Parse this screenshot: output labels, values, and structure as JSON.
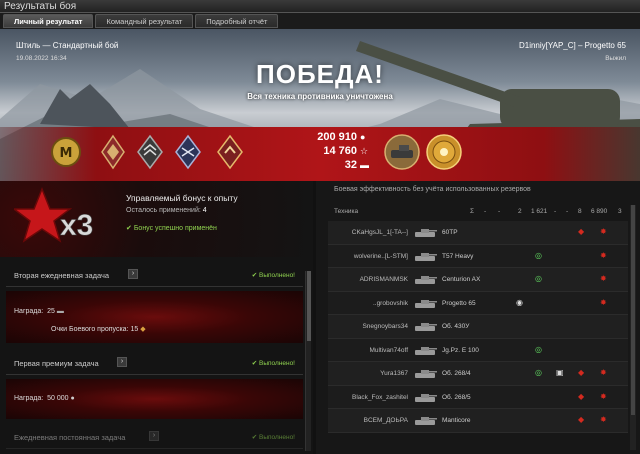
{
  "window": {
    "title": "Результаты боя"
  },
  "tabs": [
    {
      "label": "Личный результат",
      "active": true
    },
    {
      "label": "Командный результат",
      "active": false
    },
    {
      "label": "Подробный отчёт",
      "active": false
    }
  ],
  "battle": {
    "map_mode": "Штиль — Стандартный бой",
    "date": "19.08.2022 16:34",
    "player": "D1inniy[YAP_C] – Progetto 65",
    "status": "Выжил",
    "result": "ПОБЕДА!",
    "result_sub": "Вся техника противника уничтожена"
  },
  "stats": {
    "credits": "200 910",
    "credits_icon": "credits-icon",
    "xp": "14 760",
    "xp_icon": "star-icon",
    "bonds": "32",
    "bonds_icon": "bonds-icon"
  },
  "medals_left": [
    "mastery-badge-icon",
    "rank-badge-1-icon",
    "rank-badge-2-icon",
    "rank-badge-3-icon",
    "rank-badge-4-icon"
  ],
  "medals_right": [
    "tank-medal-icon",
    "gold-medal-icon"
  ],
  "bonus": {
    "multiplier": "x3",
    "title": "Управляемый бонус к опыту",
    "remaining_label": "Осталось применений:",
    "remaining_value": "4",
    "applied": "Бонус успешно применён"
  },
  "tasks": [
    {
      "name": "Вторая ежедневная задача",
      "status": "Выполнено!",
      "reward_label": "Награда:",
      "reward_value": "25",
      "pass_label": "Очки Боевого пропуска:",
      "pass_value": "15"
    },
    {
      "name": "Первая премиум задача",
      "status": "Выполнено!",
      "reward_label": "Награда:",
      "reward_value": "50 000"
    },
    {
      "name": "Ежедневная постоянная задача",
      "status": "Выполнено!"
    }
  ],
  "efficiency": {
    "title": "Боевая эффективность без учёта использованных резервов",
    "columns": {
      "tech": "Техника",
      "sigma": "Σ",
      "d1": "-",
      "d2": "-",
      "c2": "2",
      "c1621": "1 621",
      "d3": "-",
      "d4": "-",
      "c8": "8",
      "c6890": "6 890",
      "c3": "3"
    },
    "players": [
      {
        "player": "CKaHgsJL_1[-TA--]",
        "tank": "60TP"
      },
      {
        "player": "wolverine..[L-STM]",
        "tank": "T57 Heavy"
      },
      {
        "player": "ADRISMANMSK",
        "tank": "Centurion AX"
      },
      {
        "player": "..grobovshik",
        "tank": "Progetto 65"
      },
      {
        "player": "Snegnoybars34",
        "tank": "Об. 430У"
      },
      {
        "player": "Multivan74off",
        "tank": "Jg.Pz. E 100"
      },
      {
        "player": "Yura1367",
        "tank": "Об. 268/4"
      },
      {
        "player": "Black_Fox_zashitel",
        "tank": "Об. 268/5"
      },
      {
        "player": "BCEM_ДОЬРА",
        "tank": "Manticore"
      }
    ]
  },
  "colors": {
    "ribbon": "#b01518",
    "success": "#8fd14f",
    "assist": "#5fd35f",
    "damage": "#d42a1f"
  }
}
